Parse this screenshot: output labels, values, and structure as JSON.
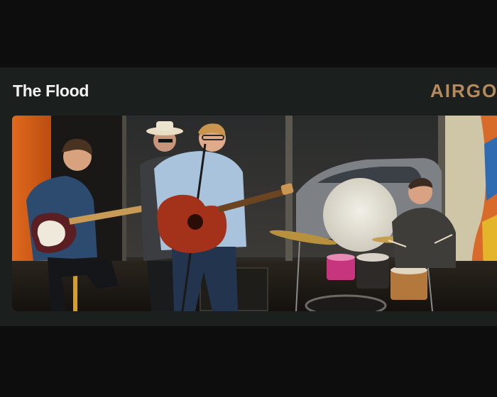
{
  "card": {
    "title": "The Flood",
    "brand_logo_text": "AIRGO"
  },
  "photo": {
    "subject": "band-performing-live"
  },
  "colors": {
    "page_background": "#0d0d0d",
    "card_background": "#1b1f1d",
    "title_text": "#f2f2f2",
    "brand_accent": "#b58a5c"
  }
}
